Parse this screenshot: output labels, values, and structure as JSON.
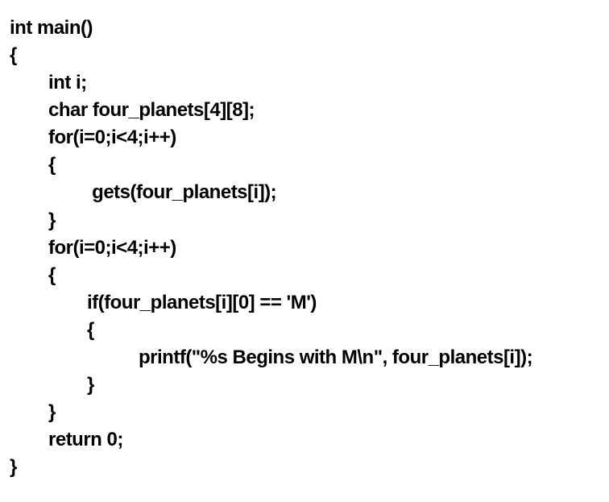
{
  "code": {
    "line1": "int main()",
    "line2": "{",
    "line3": "int i;",
    "line4": "char four_planets[4][8];",
    "line5": "for(i=0;i<4;i++)",
    "line6": "{",
    "line7": " gets(four_planets[i]);",
    "line8": "}",
    "line9": "for(i=0;i<4;i++)",
    "line10": "{",
    "line11": "if(four_planets[i][0] == 'M')",
    "line12": "{",
    "line13": "printf(\"%s Begins with M\\n\", four_planets[i]);",
    "line14": "}",
    "line15": "}",
    "line16": "return 0;",
    "line17": "}"
  }
}
